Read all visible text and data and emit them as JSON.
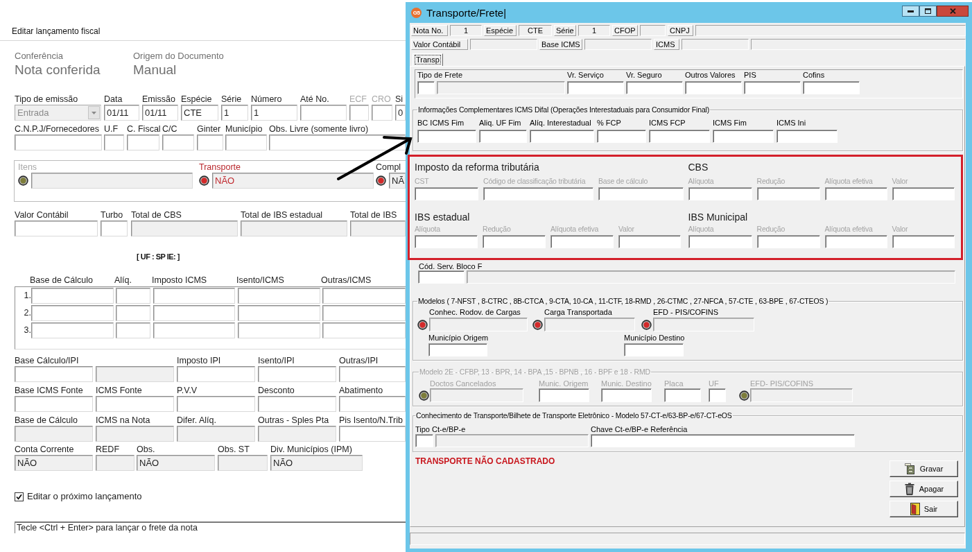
{
  "form": {
    "title": "Editar lançamento fiscal",
    "summary": [
      {
        "label": "Conferência",
        "value": "Nota conferida"
      },
      {
        "label": "Origem do Documento",
        "value": "Manual"
      }
    ],
    "field_rows": [
      [
        {
          "label": "Tipo de emissão",
          "value": "Entrada",
          "kind": "dropdown",
          "disabled": false
        },
        {
          "label": "Data",
          "value": "01/11",
          "kind": "input",
          "disabled": false
        },
        {
          "label": "Emissão",
          "value": "01/11",
          "kind": "input",
          "disabled": false
        },
        {
          "label": "Espécie",
          "value": "CTE",
          "kind": "input",
          "disabled": false
        },
        {
          "label": "Série",
          "value": "1",
          "kind": "input",
          "disabled": false
        },
        {
          "label": "Número",
          "value": "1",
          "kind": "input",
          "disabled": false
        },
        {
          "label": "Até No.",
          "kind": "input",
          "disabled": false
        },
        {
          "label": "ECF",
          "kind": "input",
          "disabled": true
        },
        {
          "label": "CRO",
          "kind": "input",
          "disabled": true
        },
        {
          "label": "Si",
          "value": "0",
          "kind": "input",
          "disabled": false
        }
      ],
      [
        {
          "label": "C.N.P.J/Fornecedores",
          "kind": "input"
        },
        {
          "label": "U.F",
          "kind": "input"
        },
        {
          "label": "C. Fiscal",
          "kind": "input"
        },
        {
          "label": "C/C",
          "kind": "input"
        },
        {
          "label": "Ginter",
          "kind": "input"
        },
        {
          "label": "Município",
          "kind": "input"
        },
        {
          "label": "Obs. Livre (somente livro)",
          "kind": "input"
        }
      ]
    ],
    "indicators": [
      {
        "label": "Itens",
        "color": "#7d7d3a",
        "disabled": true,
        "alert": false
      },
      {
        "label": "Transporte",
        "value": "NÃO",
        "color": "#d42a2a",
        "disabled": false,
        "alert": true
      },
      {
        "label": "Compl",
        "value": "NÃ",
        "color": "#d42a2a",
        "disabled": false,
        "alert": false
      }
    ],
    "totals": [
      {
        "label": "Valor Contábil",
        "kind": "input"
      },
      {
        "label": "Turbo",
        "kind": "input"
      },
      {
        "label": "Total de CBS",
        "kind": "readonly"
      },
      {
        "label": "Total de IBS estadual",
        "kind": "readonly"
      },
      {
        "label": "Total de IBS",
        "kind": "readonly"
      }
    ],
    "state_note": "[ UF : SP IE: ]",
    "icms_table": {
      "columns": [
        "Base de Cálculo",
        "Alíq.",
        "Imposto ICMS",
        "Isento/ICMS",
        "Outras/ICMS"
      ],
      "rows": [
        {
          "number": "1."
        },
        {
          "number": "2."
        },
        {
          "number": "3."
        }
      ]
    },
    "tax_rows": [
      [
        {
          "label": "Base Cálculo/IPI",
          "kind": "input"
        },
        {
          "kind": "readonly"
        },
        {
          "label": "Imposto IPI",
          "kind": "input"
        },
        {
          "label": "Isento/IPI",
          "kind": "input"
        },
        {
          "label": "Outras/IPI",
          "kind": "input"
        }
      ],
      [
        {
          "label": "Base ICMS Fonte",
          "kind": "input"
        },
        {
          "label": "ICMS Fonte",
          "kind": "input"
        },
        {
          "label": "P.V.V",
          "kind": "input"
        },
        {
          "label": "Desconto",
          "kind": "input"
        },
        {
          "label": "Abatimento",
          "kind": "input"
        }
      ],
      [
        {
          "label": "Base de Cálculo",
          "kind": "readonly"
        },
        {
          "label": "ICMS na Nota",
          "kind": "readonly"
        },
        {
          "label": "Difer. Alíq.",
          "kind": "readonly"
        },
        {
          "label": "Outras - Sples Pta",
          "kind": "readonly"
        },
        {
          "label": "Pis Isento/N.Trib",
          "kind": "input"
        }
      ]
    ],
    "account_row": [
      {
        "label": "Conta Corrente",
        "value": "NÃO",
        "kind": "readonly"
      },
      {
        "label": "REDF",
        "kind": "readonly"
      },
      {
        "label": "Obs.",
        "value": "NÃO",
        "kind": "readonly"
      },
      {
        "label": "Obs. ST",
        "kind": "readonly"
      },
      {
        "label": "Div. Municípios (IPM)",
        "value": "NÃO",
        "kind": "readonly"
      }
    ],
    "edit_next": {
      "label": "Editar o próximo lançamento",
      "checked": true
    },
    "status_text": "Tecle <Ctrl + Enter> para lançar o frete da nota"
  },
  "dialog": {
    "logo": "G5",
    "title": "Transporte/Frete|",
    "header_rows": [
      [
        {
          "kind": "label",
          "text": "Nota No."
        },
        {
          "kind": "value",
          "text": "1"
        },
        {
          "kind": "label",
          "text": "Espécie"
        },
        {
          "kind": "value",
          "text": "CTE"
        },
        {
          "kind": "label",
          "text": "Série"
        },
        {
          "kind": "value",
          "text": "1"
        },
        {
          "kind": "label",
          "text": "CFOP"
        },
        {
          "kind": "value"
        },
        {
          "kind": "label",
          "text": "CNPJ"
        },
        {
          "kind": "value"
        }
      ],
      [
        {
          "kind": "label",
          "text": "Valor Contábil"
        },
        {
          "kind": "value"
        },
        {
          "kind": "label",
          "text": "Base ICMS"
        },
        {
          "kind": "value"
        },
        {
          "kind": "label",
          "text": "ICMS"
        },
        {
          "kind": "value"
        },
        {
          "kind": "value"
        }
      ]
    ],
    "tabs": [
      {
        "label": "Transp",
        "selected": true
      }
    ],
    "freight": [
      {
        "label": "Tipo de Frete",
        "kind": "input"
      },
      {
        "kind": "readonly"
      },
      {
        "label": "Vr. Serviço",
        "kind": "input"
      },
      {
        "label": "Vr. Seguro",
        "kind": "input"
      },
      {
        "label": "Outros Valores",
        "kind": "input"
      },
      {
        "label": "PIS",
        "kind": "input"
      },
      {
        "label": "Cofins",
        "kind": "input"
      }
    ],
    "difal": {
      "title": "Informações Complementares ICMS Difal (Operações Interestaduais para Consumidor Final)",
      "fields": [
        {
          "label": "BC ICMS Fim",
          "kind": "input"
        },
        {
          "label": "Aliq. UF Fim",
          "kind": "input"
        },
        {
          "label": "Alíq. Interestadual",
          "kind": "input"
        },
        {
          "label": "% FCP",
          "kind": "input"
        },
        {
          "label": "ICMS FCP",
          "kind": "input"
        },
        {
          "label": "ICMS Fim",
          "kind": "input"
        },
        {
          "label": "ICMS Ini",
          "kind": "input"
        }
      ]
    },
    "reform": [
      [
        {
          "title": "Imposto da reforma tributária",
          "fields": [
            {
              "label": "CST",
              "kind": "input"
            },
            {
              "label": "Código de classificação tributária",
              "kind": "input"
            },
            {
              "label": "Base de cálculo",
              "kind": "input"
            }
          ]
        },
        {
          "title": "CBS",
          "fields": [
            {
              "label": "Alíquota",
              "kind": "input"
            },
            {
              "label": "Redução",
              "kind": "input"
            },
            {
              "label": "Alíquota efetiva",
              "kind": "input"
            },
            {
              "label": "Valor",
              "kind": "input"
            }
          ]
        }
      ],
      [
        {
          "title": "IBS estadual",
          "fields": [
            {
              "label": "Alíquota",
              "kind": "input"
            },
            {
              "label": "Redução",
              "kind": "input"
            },
            {
              "label": "Alíquota efetiva",
              "kind": "input"
            },
            {
              "label": "Valor",
              "kind": "input"
            }
          ]
        },
        {
          "title": "IBS Municipal",
          "fields": [
            {
              "label": "Alíquota",
              "kind": "input"
            },
            {
              "label": "Redução",
              "kind": "input"
            },
            {
              "label": "Alíquota efetiva",
              "kind": "input"
            },
            {
              "label": "Valor",
              "kind": "input"
            }
          ]
        }
      ]
    ],
    "service_code": {
      "label": "Cód. Serv. Bloco F",
      "fields": [
        {
          "kind": "input"
        },
        {
          "kind": "readonly"
        }
      ]
    },
    "models": {
      "title": "Modelos ( 7-NFST , 8-CTRC , 8B-CTCA , 9-CTA, 10-CA , 11-CTF, 18-RMD , 26-CTMC , 27-NFCA , 57-CTE , 63-BPE , 67-CTEOS )",
      "disabled": false,
      "indicators": [
        {
          "label": "Conhec. Rodov. de Cargas",
          "color": "#d42a2a"
        },
        {
          "label": "Carga Transportada",
          "color": "#d42a2a"
        },
        {
          "label": "EFD - PIS/COFINS",
          "color": "#d42a2a"
        }
      ],
      "fields": [
        {
          "label": "Município Origem",
          "kind": "input"
        },
        {
          "label": "Município Destino",
          "kind": "input"
        }
      ]
    },
    "model_2e": {
      "title": "Modelo 2E - CFBP, 13 - BPR, 14 - BPA ,15 - BPNB , 16 - BPF e 18 - RMD",
      "disabled": true,
      "items": [
        {
          "kind": "indicator",
          "label": "Doctos Cancelados",
          "color": "#7d7d3a"
        },
        {
          "kind": "input",
          "label": "Munic. Origem"
        },
        {
          "kind": "input",
          "label": "Munic. Destino"
        },
        {
          "kind": "input",
          "label": "Placa"
        },
        {
          "kind": "input",
          "label": "UF"
        },
        {
          "kind": "indicator",
          "label": "EFD- PIS/COFINS",
          "color": "#7d7d3a"
        }
      ]
    },
    "cte": {
      "title": "Conhecimento de Transporte/Bilhete de Transporte Eletrônico - Modelo 57-CT-e/63-BP-e/67-CT-eOS",
      "fields": [
        {
          "label": "Tipo Ct-e/BP-e",
          "kind": "input"
        },
        {
          "kind": "readonly"
        },
        {
          "label": "Chave Ct-e/BP-e Referência",
          "kind": "input"
        }
      ]
    },
    "message": "TRANSPORTE NÃO CADASTRADO",
    "buttons": [
      {
        "label": "Gravar",
        "kind": "save"
      },
      {
        "label": "Apagar",
        "kind": "delete"
      },
      {
        "label": "Sair",
        "kind": "exit"
      }
    ]
  }
}
